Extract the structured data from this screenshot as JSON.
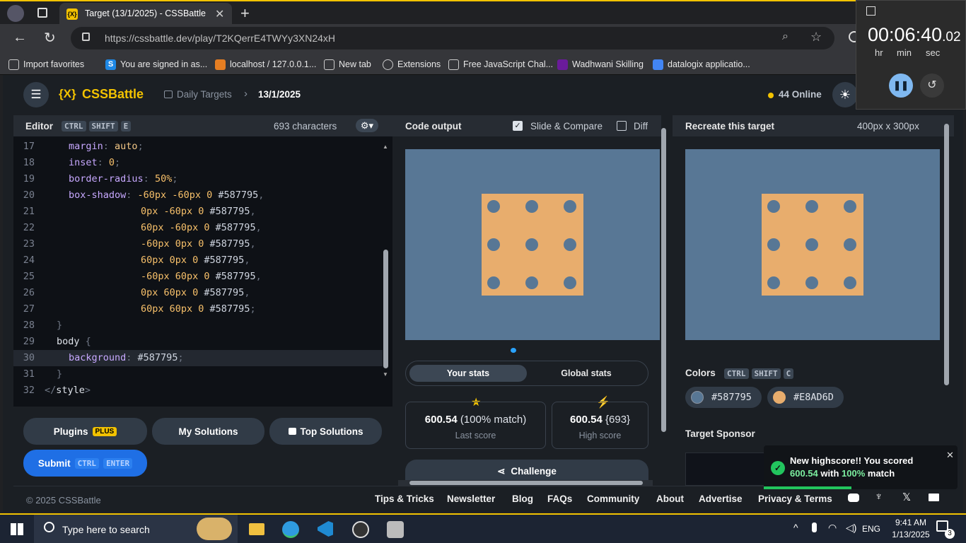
{
  "browser": {
    "tab_title": "Target (13/1/2025) - CSSBattle",
    "url": "https://cssbattle.dev/play/T2KQerrE4TWYy3XN24xH",
    "favorites": [
      {
        "label": "Import favorites",
        "icon": "import-icon",
        "color": "#cccccc"
      },
      {
        "label": "You are signed in as...",
        "icon": "s-icon",
        "color": "#1e88e5"
      },
      {
        "label": "localhost / 127.0.0.1...",
        "icon": "phpmyadmin-icon",
        "color": "#e67e22"
      },
      {
        "label": "New tab",
        "icon": "newtab-icon",
        "color": "#cccccc"
      },
      {
        "label": "Extensions",
        "icon": "puzzle-icon",
        "color": "#cccccc"
      },
      {
        "label": "Free JavaScript Chal...",
        "icon": "cube-icon",
        "color": "#cccccc"
      },
      {
        "label": "Wadhwani Skilling",
        "icon": "w-icon",
        "color": "#6a1b9a"
      },
      {
        "label": "datalogix applicatio...",
        "icon": "doc-icon",
        "color": "#4285f4"
      }
    ]
  },
  "timer": {
    "time": "00:06:40",
    "fraction": ".02",
    "units": [
      "hr",
      "min",
      "sec"
    ]
  },
  "nav": {
    "logo": "CSSBattle",
    "logo_mark": "{X}",
    "crumb1": "Daily Targets",
    "crumb2": "13/1/2025",
    "online": "44 Online"
  },
  "editor": {
    "title": "Editor",
    "shortcut": [
      "CTRL",
      "SHIFT",
      "E"
    ],
    "chars": "693 characters",
    "lines": [
      {
        "n": "17",
        "indent": 2,
        "parts": [
          [
            "kw",
            "margin"
          ],
          [
            "br",
            ": "
          ],
          [
            "val",
            "auto"
          ],
          [
            "br",
            ";"
          ]
        ]
      },
      {
        "n": "18",
        "indent": 2,
        "parts": [
          [
            "kw",
            "inset"
          ],
          [
            "br",
            ": "
          ],
          [
            "num",
            "0"
          ],
          [
            "br",
            ";"
          ]
        ]
      },
      {
        "n": "19",
        "indent": 2,
        "parts": [
          [
            "kw",
            "border-radius"
          ],
          [
            "br",
            ": "
          ],
          [
            "num",
            "50%"
          ],
          [
            "br",
            ";"
          ]
        ]
      },
      {
        "n": "20",
        "indent": 2,
        "parts": [
          [
            "kw",
            "box-shadow"
          ],
          [
            "br",
            ": "
          ],
          [
            "num",
            "-60px -60px 0 "
          ],
          [
            "hex",
            "#587795"
          ],
          [
            "br",
            ","
          ]
        ]
      },
      {
        "n": "21",
        "indent": 8,
        "parts": [
          [
            "num",
            "0px -60px 0 "
          ],
          [
            "hex",
            "#587795"
          ],
          [
            "br",
            ","
          ]
        ]
      },
      {
        "n": "22",
        "indent": 8,
        "parts": [
          [
            "num",
            "60px -60px 0 "
          ],
          [
            "hex",
            "#587795"
          ],
          [
            "br",
            ","
          ]
        ]
      },
      {
        "n": "23",
        "indent": 8,
        "parts": [
          [
            "num",
            "-60px 0px 0 "
          ],
          [
            "hex",
            "#587795"
          ],
          [
            "br",
            ","
          ]
        ]
      },
      {
        "n": "24",
        "indent": 8,
        "parts": [
          [
            "num",
            "60px 0px 0 "
          ],
          [
            "hex",
            "#587795"
          ],
          [
            "br",
            ","
          ]
        ]
      },
      {
        "n": "25",
        "indent": 8,
        "parts": [
          [
            "num",
            "-60px 60px 0 "
          ],
          [
            "hex",
            "#587795"
          ],
          [
            "br",
            ","
          ]
        ]
      },
      {
        "n": "26",
        "indent": 8,
        "parts": [
          [
            "num",
            "0px 60px 0 "
          ],
          [
            "hex",
            "#587795"
          ],
          [
            "br",
            ","
          ]
        ]
      },
      {
        "n": "27",
        "indent": 8,
        "parts": [
          [
            "num",
            "60px 60px 0 "
          ],
          [
            "hex",
            "#587795"
          ],
          [
            "br",
            ";"
          ]
        ]
      },
      {
        "n": "28",
        "indent": 1,
        "parts": [
          [
            "br",
            "}"
          ]
        ]
      },
      {
        "n": "29",
        "indent": 1,
        "parts": [
          [
            "tag",
            "body "
          ],
          [
            "br",
            "{"
          ]
        ]
      },
      {
        "n": "30",
        "indent": 2,
        "parts": [
          [
            "kw",
            "background"
          ],
          [
            "br",
            ": "
          ],
          [
            "hex",
            "#587795"
          ],
          [
            "br",
            ";"
          ]
        ]
      },
      {
        "n": "31",
        "indent": 1,
        "parts": [
          [
            "br",
            "}"
          ]
        ]
      },
      {
        "n": "32",
        "indent": 0,
        "parts": [
          [
            "br",
            "</"
          ],
          [
            "tag",
            "style"
          ],
          [
            "br",
            ">"
          ]
        ]
      }
    ]
  },
  "buttons": {
    "plugins": "Plugins",
    "plus": "PLUS",
    "my_solutions": "My Solutions",
    "top_solutions": "Top Solutions",
    "submit": "Submit",
    "submit_keys": [
      "CTRL",
      "ENTER"
    ]
  },
  "output": {
    "title": "Code output",
    "slide_compare": "Slide & Compare",
    "diff": "Diff",
    "tab_your": "Your stats",
    "tab_global": "Global stats",
    "last_score": "600.54",
    "last_match": "(100% match)",
    "last_label": "Last score",
    "high_score": "600.54",
    "high_chars": "{693}",
    "high_label": "High score",
    "challenge": "Challenge"
  },
  "target": {
    "title": "Recreate this target",
    "size": "400px x 300px",
    "colors_label": "Colors",
    "colors_keys": [
      "CTRL",
      "SHIFT",
      "C"
    ],
    "colors": [
      {
        "hex": "#587795",
        "name": "#587795"
      },
      {
        "hex": "#E8AD6D",
        "name": "#E8AD6D"
      }
    ],
    "sponsor": "Target Sponsor",
    "bg": "#587795",
    "fg": "#E8AD6D"
  },
  "footer": {
    "copyright": "© 2025 CSSBattle",
    "links": [
      "Tips & Tricks",
      "Newsletter",
      "Blog",
      "FAQs",
      "Community",
      "About",
      "Advertise",
      "Privacy & Terms"
    ]
  },
  "toast": {
    "line1": "New highscore!! You scored",
    "score": "600.54",
    "with": "with",
    "pct": "100%",
    "match": "match"
  },
  "taskbar": {
    "search": "Type here to search",
    "lang": "ENG",
    "time": "9:41 AM",
    "date": "1/13/2025",
    "notif": "3"
  }
}
